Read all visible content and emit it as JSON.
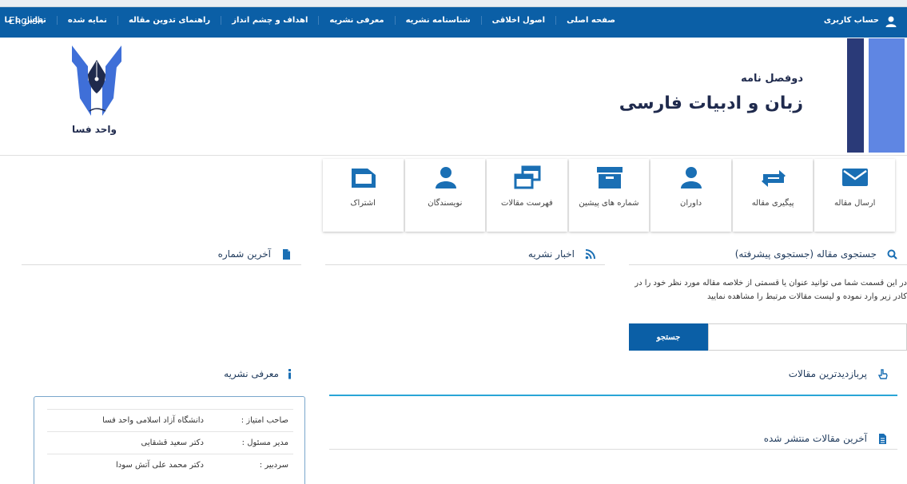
{
  "nav": {
    "account": "حساب کاربری",
    "items": [
      "صفحه اصلی",
      "اصول اخلاقی",
      "شناسنامه نشریه",
      "معرفی نشریه",
      "اهداف و چشم انداز",
      "راهنمای تدوین مقاله",
      "نمایه شده",
      "تماس با ما"
    ],
    "english": "English"
  },
  "header": {
    "subtitle": "دوفصل نامه",
    "title": "زبان و ادبیات فارسی",
    "logo_caption": "واحد فسا"
  },
  "tiles": [
    {
      "label": "ارسال مقاله",
      "icon": "envelope-icon"
    },
    {
      "label": "پیگیری مقاله",
      "icon": "exchange-icon"
    },
    {
      "label": "داوران",
      "icon": "user-icon"
    },
    {
      "label": "شماره های پیشین",
      "icon": "archive-icon"
    },
    {
      "label": "فهرست مقالات",
      "icon": "windows-icon"
    },
    {
      "label": "نویسندگان",
      "icon": "user-icon"
    },
    {
      "label": "اشتراک",
      "icon": "folder-icon"
    }
  ],
  "search": {
    "title": "جستجوی مقاله (جستجوی پیشرفته)",
    "description_line1": "در این قسمت شما می توانید عنوان یا قسمتی از خلاصه مقاله مورد نظر خود را در",
    "description_line2": "کادر زیر وارد نموده و لیست مقالات مرتبط را مشاهده نمایید",
    "button": "جستجو",
    "placeholder": ""
  },
  "news": {
    "title": "اخبار نشریه"
  },
  "latest_issue": {
    "title": "آخرین شماره"
  },
  "most_viewed": {
    "title": "پربازدیدترین مقالات"
  },
  "latest_articles": {
    "title": "آخرین مقالات منتشر شده"
  },
  "intro": {
    "title": "معرفی نشریه",
    "rows": [
      {
        "key": "صاحب امتیاز :",
        "value": "دانشگاه آزاد اسلامی واحد فسا"
      },
      {
        "key": "مدیر مسئول :",
        "value": "دکتر سعید قشقایی"
      },
      {
        "key": "سردبیر :",
        "value": "دکتر محمد علی آتش سودا"
      }
    ]
  },
  "colors": {
    "primary": "#0b5fa6",
    "dark_stripe": "#2a3a78",
    "light_stripe": "#5f86e3",
    "accent_line": "#2aa5d6"
  }
}
